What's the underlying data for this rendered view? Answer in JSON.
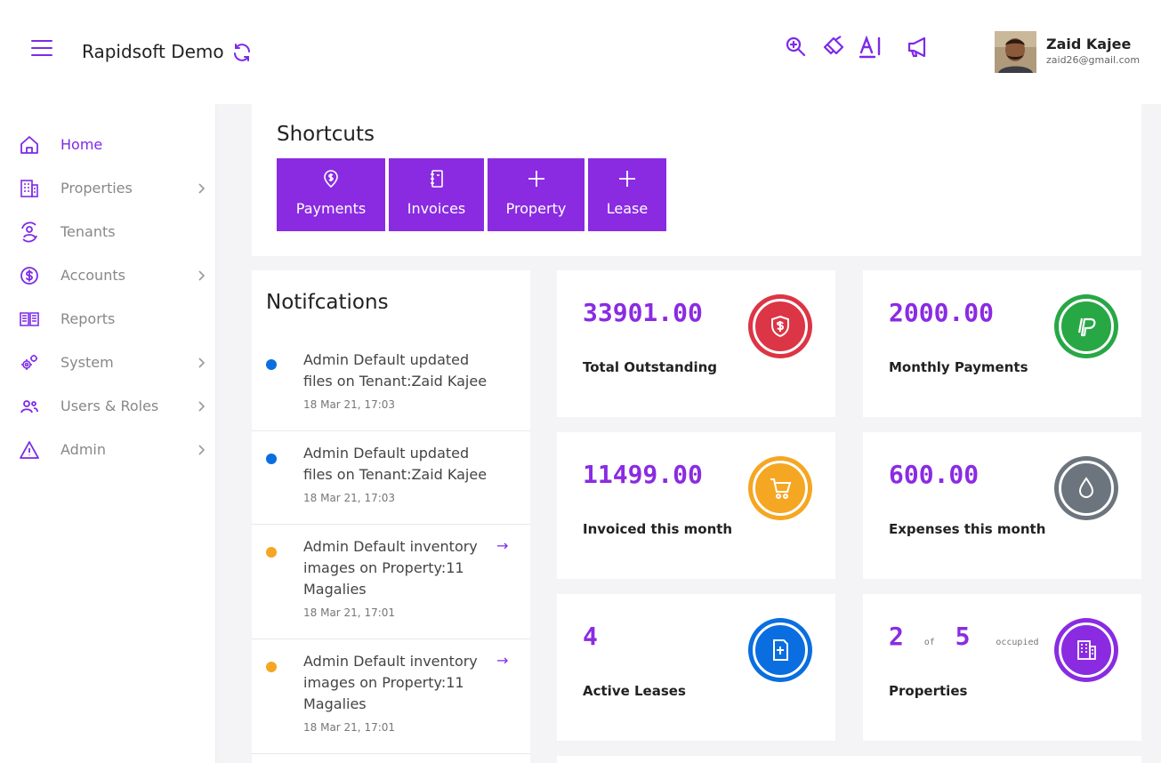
{
  "header": {
    "app_title": "Rapidsoft Demo",
    "user_name": "Zaid Kajee",
    "user_email": "zaid26@gmail.com"
  },
  "sidebar": {
    "items": [
      {
        "label": "Home"
      },
      {
        "label": "Properties"
      },
      {
        "label": "Tenants"
      },
      {
        "label": "Accounts"
      },
      {
        "label": "Reports"
      },
      {
        "label": "System"
      },
      {
        "label": "Users & Roles"
      },
      {
        "label": "Admin"
      }
    ]
  },
  "shortcuts": {
    "title": "Shortcuts",
    "buttons": [
      {
        "label": "Payments"
      },
      {
        "label": "Invoices"
      },
      {
        "label": "Property"
      },
      {
        "label": "Lease"
      }
    ]
  },
  "notifications": {
    "title": "Notifcations",
    "items": [
      {
        "text": "Admin Default updated files on Tenant:Zaid Kajee",
        "time": "18 Mar 21, 17:03",
        "color": "#0a6ee0"
      },
      {
        "text": "Admin Default updated files on Tenant:Zaid Kajee",
        "time": "18 Mar 21, 17:03",
        "color": "#0a6ee0"
      },
      {
        "text": "Admin Default inventory images on Property:11 Magalies",
        "time": "18 Mar 21, 17:01",
        "color": "#f5a623",
        "arrow": "→"
      },
      {
        "text": "Admin Default inventory images on Property:11 Magalies",
        "time": "18 Mar 21, 17:01",
        "color": "#f5a623",
        "arrow": "→"
      }
    ]
  },
  "stats": {
    "total_outstanding": {
      "value": "33901.00",
      "label": "Total Outstanding",
      "color": "#dc3545"
    },
    "monthly_payments": {
      "value": "2000.00",
      "label": "Monthly Payments",
      "color": "#28a745"
    },
    "invoiced": {
      "value": "11499.00",
      "label": "Invoiced this month",
      "color": "#f5a623"
    },
    "expenses": {
      "value": "600.00",
      "label": "Expenses this month",
      "color": "#6c757d"
    },
    "active_leases": {
      "value": "4",
      "label": "Active Leases",
      "color": "#0a6ee0"
    },
    "properties": {
      "occupied": "2",
      "of": "of",
      "total": "5",
      "suffix": "occupied",
      "label": "Properties",
      "color": "#8a2be2"
    }
  },
  "colors": {
    "accent": "#8a2be2"
  }
}
